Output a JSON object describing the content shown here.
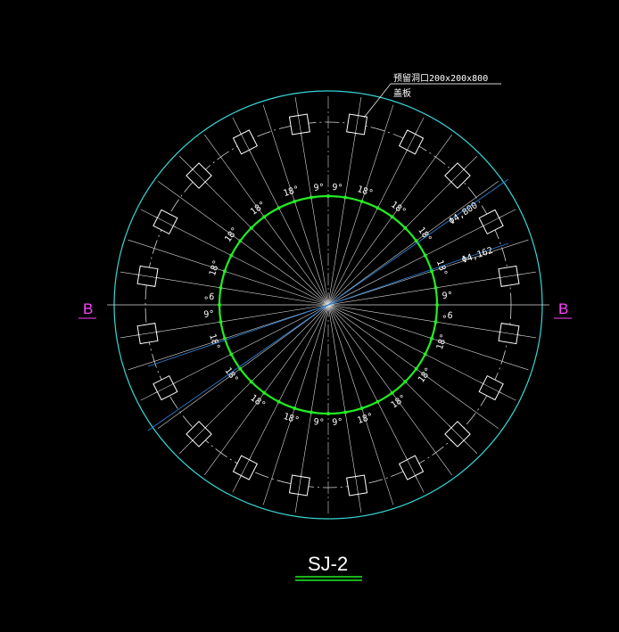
{
  "drawing": {
    "title": "SJ-2",
    "section_marker_left": "B",
    "section_marker_right": "B",
    "callout_line1": "预留洞口200x200x800",
    "callout_line2": "盖板",
    "dimension_outer": "Φ4,800",
    "dimension_inner": "Φ4,162",
    "hole_count": 20,
    "angle_labels_right": [
      "9°",
      "18°",
      "18°",
      "18°",
      "18°",
      "9°",
      "9°",
      "18°",
      "18°",
      "18°",
      "18°",
      "9°"
    ],
    "angle_labels_left": [
      "9°",
      "18°",
      "18°",
      "18°",
      "18°",
      "9°",
      "9°",
      "18°",
      "18°",
      "18°",
      "18°",
      "9°"
    ],
    "colors": {
      "background": "#000000",
      "outer_circle": "#38d6d6",
      "inner_circle": "#22ee22",
      "radial_lines": "#d8d8d8",
      "dimension_lines": "#2a7fd4",
      "section_marker": "#ff44ff",
      "title_underline": "#22ee22",
      "text": "#ffffff"
    }
  }
}
